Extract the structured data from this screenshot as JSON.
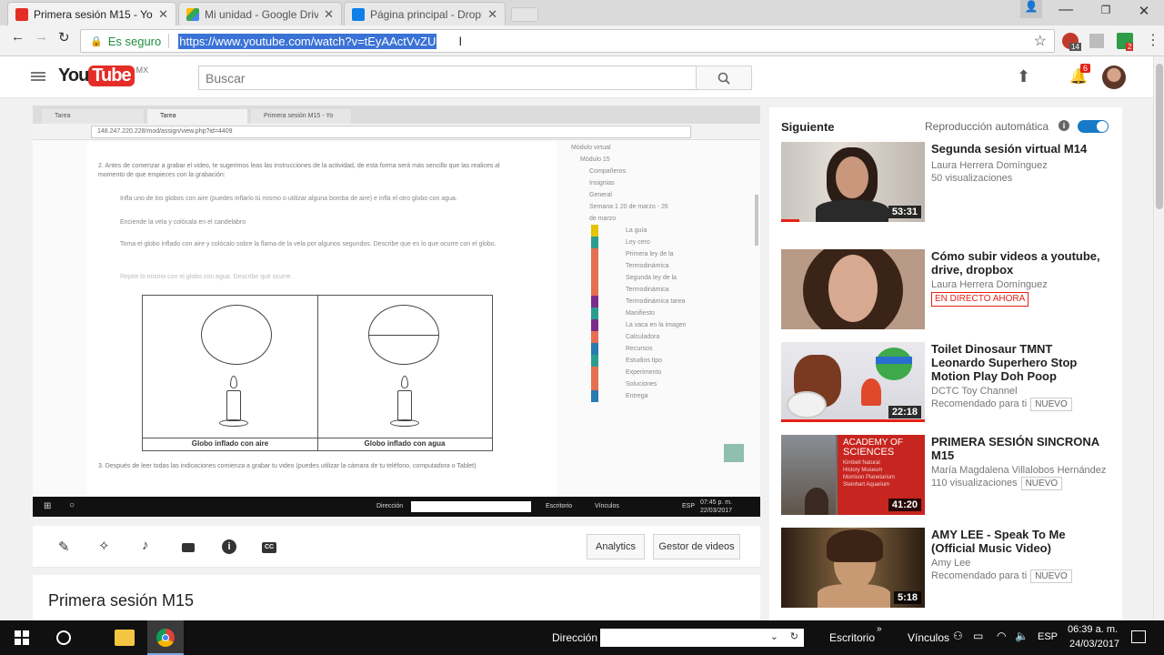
{
  "browser": {
    "tabs": [
      {
        "label": "Primera sesión M15 - Yo",
        "icon": "youtube-icon",
        "active": true
      },
      {
        "label": "Mi unidad - Google Driv",
        "icon": "google-drive-icon",
        "active": false
      },
      {
        "label": "Página principal - Dropb",
        "icon": "dropbox-icon",
        "active": false
      }
    ],
    "secure_label": "Es seguro",
    "url": "https://www.youtube.com/watch?v=tEyAActVvZU",
    "ext_badges": [
      "14",
      "2"
    ]
  },
  "youtube": {
    "logo_text": "YouTube",
    "region": "MX",
    "search_placeholder": "Buscar",
    "notifications": "6",
    "video_title": "Primera sesión M15",
    "actions": {
      "analytics": "Analytics",
      "manager": "Gestor de videos"
    }
  },
  "inner_screen": {
    "tabs": [
      "Tarea",
      "Tarea",
      "Primera sesión M15 - Yo"
    ],
    "url": "148.247.220.228/mod/assign/view.php?id=4409",
    "lines": [
      "2. Antes de comenzar a grabar el video, te sugerimos leas las instrucciones de la actividad, de esta forma será más sencillo que las realices al momento de que empieces con la grabación:",
      "Infla uno de los globos con aire (puedes inflarlo tú mismo o utilizar alguna bomba de aire) e infla el otro globo con agua.",
      "Enciende la vela y colócala en el candelabro",
      "Toma el globo inflado con aire y colócalo sobre la flama de la vela por algunos segundos. Describe que es lo que ocurre con el globo.",
      "Repite lo mismo con el globo con agua. Describe qué ocurre."
    ],
    "left_caption": "Globo inflado con aire",
    "right_caption": "Globo inflado con agua",
    "bottom_line": "3. Después de leer todas las indicaciones comienza a grabar tu video (puedes utilizar la cámara de tu teléfono, computadora o Tablet)",
    "nav": [
      "Módulo virtual",
      "Módulo 15",
      "Compañeros",
      "Insignias",
      "General",
      "Semana 1 20 de marzo - 26 de marzo",
      "La guía",
      "Ley cero",
      "Primera ley de la Termodinámica",
      "Segunda ley de la Termodinámica",
      "Termodinámica tarea",
      "Manifiesto",
      "La vaca en la imagen",
      "Calculadora",
      "Recursos",
      "Estudios tipo",
      "Experimento",
      "Soluciones",
      "Entrega"
    ],
    "taskbar": {
      "direccion": "Dirección",
      "escritorio": "Escritorio",
      "vinculos": "Vínculos",
      "lang": "ESP",
      "time": "07:45 p. m.",
      "date": "22/03/2017"
    }
  },
  "sidebar": {
    "up_next": "Siguiente",
    "autoplay": "Reproducción automática",
    "autoplay_on": true,
    "items": [
      {
        "title": "Segunda sesión virtual M14",
        "channel": "Laura Herrera Domínguez",
        "meta": "50 visualizaciones",
        "duration": "53:31",
        "badge": "",
        "live": ""
      },
      {
        "title": "Cómo subir videos a youtube, drive, dropbox",
        "channel": "Laura Herrera Domínguez",
        "meta": "",
        "duration": "",
        "badge": "",
        "live": "EN DIRECTO AHORA"
      },
      {
        "title": "Toilet Dinosaur TMNT Leonardo Superhero Stop Motion Play Doh Poop",
        "channel": "DCTC Toy Channel",
        "meta": "Recomendado para ti",
        "duration": "22:18",
        "badge": "NUEVO",
        "live": ""
      },
      {
        "title": "PRIMERA SESIÓN SINCRONA M15",
        "channel": "María Magdalena Villalobos Hernández",
        "meta": "110 visualizaciones",
        "duration": "41:20",
        "badge": "NUEVO",
        "live": ""
      },
      {
        "title": "AMY LEE - Speak To Me (Official Music Video)",
        "channel": "Amy Lee",
        "meta": "Recomendado para ti",
        "duration": "5:18",
        "badge": "NUEVO",
        "live": ""
      }
    ],
    "academy_text": [
      "ACADEMY OF",
      "SCIENCES",
      "Kimbell Natural",
      "History Museum",
      "Morrison Planetarium",
      "Steinhart Aquarium"
    ]
  },
  "taskbar": {
    "direccion": "Dirección",
    "escritorio": "Escritorio",
    "vinculos": "Vínculos",
    "lang": "ESP",
    "time": "06:39 a. m.",
    "date": "24/03/2017"
  }
}
